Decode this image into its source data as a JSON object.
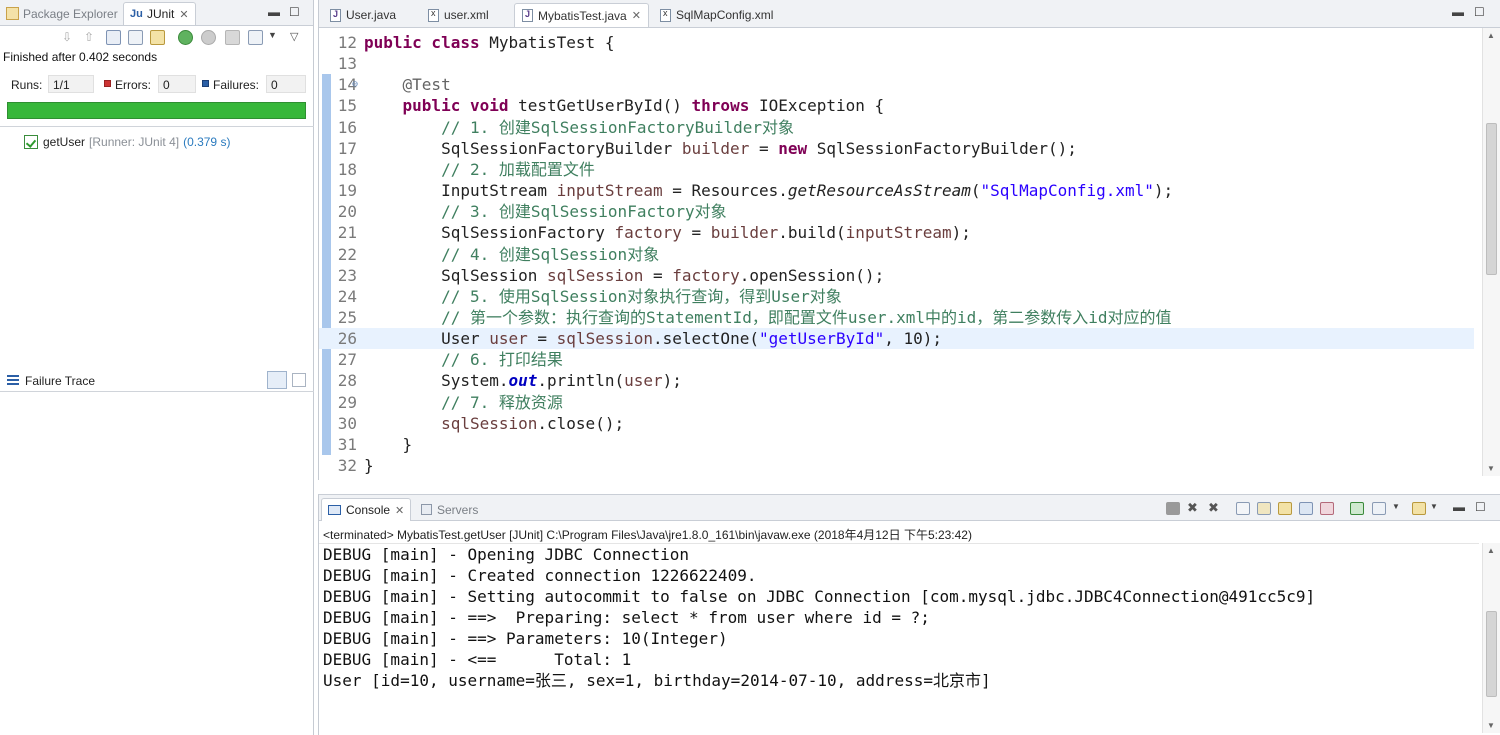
{
  "left_tabs": {
    "package_explorer": "Package Explorer",
    "junit": "JUnit"
  },
  "junit": {
    "finished": "Finished after 0.402 seconds",
    "runs_label": "Runs:",
    "runs_value": "1/1",
    "errors_label": "Errors:",
    "errors_value": "0",
    "failures_label": "Failures:",
    "failures_value": "0",
    "progress": 1.0,
    "progress_color": "#37b73a",
    "test_name": "getUser",
    "test_runner": "[Runner: JUnit 4]",
    "test_time": "(0.379 s)",
    "failure_trace": "Failure Trace"
  },
  "editor": {
    "tabs": [
      {
        "label": "User.java",
        "icon": "java-file-icon"
      },
      {
        "label": "user.xml",
        "icon": "xml-file-icon"
      },
      {
        "label": "MybatisTest.java",
        "icon": "java-file-icon",
        "active": true
      },
      {
        "label": "SqlMapConfig.xml",
        "icon": "xml-file-icon"
      }
    ],
    "lines": [
      {
        "n": "12",
        "html": "<span class=\"kw\">public class</span> MybatisTest {"
      },
      {
        "n": "13",
        "html": ""
      },
      {
        "n": "14",
        "html": "    <span class=\"ann\">@Test</span>",
        "fold": true
      },
      {
        "n": "15",
        "html": "    <span class=\"kw\">public void</span> testGetUserById() <span class=\"kw\">throws</span> IOException {"
      },
      {
        "n": "16",
        "html": "        <span class=\"cm\">// 1. 创建SqlSessionFactoryBuilder对象</span>"
      },
      {
        "n": "17",
        "html": "        SqlSessionFactoryBuilder <span class=\"var\">builder</span> = <span class=\"kw\">new</span> SqlSessionFactoryBuilder();"
      },
      {
        "n": "18",
        "html": "        <span class=\"cm\">// 2. 加载配置文件</span>"
      },
      {
        "n": "19",
        "html": "        InputStream <span class=\"var\">inputStream</span> = Resources.<span class=\"it\">getResourceAsStream</span>(<span class=\"str\">\"SqlMapConfig.xml\"</span>);"
      },
      {
        "n": "20",
        "html": "        <span class=\"cm\">// 3. 创建SqlSessionFactory对象</span>"
      },
      {
        "n": "21",
        "html": "        SqlSessionFactory <span class=\"var\">factory</span> = <span class=\"var\">builder</span>.build(<span class=\"var\">inputStream</span>);"
      },
      {
        "n": "22",
        "html": "        <span class=\"cm\">// 4. 创建SqlSession对象</span>"
      },
      {
        "n": "23",
        "html": "        SqlSession <span class=\"var\">sqlSession</span> = <span class=\"var\">factory</span>.openSession();"
      },
      {
        "n": "24",
        "html": "        <span class=\"cm\">// 5. 使用SqlSession对象执行查询，得到User对象</span>"
      },
      {
        "n": "25",
        "html": "        <span class=\"cm\">// 第一个参数：执行查询的StatementId，即配置文件user.xml中的id，第二参数传入id对应的值</span>"
      },
      {
        "n": "26",
        "html": "        User <span class=\"var\">user</span> = <span class=\"var\">sqlSession</span>.selectOne(<span class=\"str\">\"getUserById\"</span>, 10);",
        "current": true
      },
      {
        "n": "27",
        "html": "        <span class=\"cm\">// 6. 打印结果</span>"
      },
      {
        "n": "28",
        "html": "        System.<span class=\"fld\">out</span>.println(<span class=\"var\">user</span>);"
      },
      {
        "n": "29",
        "html": "        <span class=\"cm\">// 7. 释放资源</span>"
      },
      {
        "n": "30",
        "html": "        <span class=\"var\">sqlSession</span>.close();"
      },
      {
        "n": "31",
        "html": "    }"
      },
      {
        "n": "32",
        "html": "}"
      }
    ]
  },
  "console": {
    "tab_console": "Console",
    "tab_servers": "Servers",
    "status": "<terminated> MybatisTest.getUser [JUnit] C:\\Program Files\\Java\\jre1.8.0_161\\bin\\javaw.exe (2018年4月12日 下午5:23:42)",
    "output": [
      "DEBUG [main] - Opening JDBC Connection",
      "DEBUG [main] - Created connection 1226622409.",
      "DEBUG [main] - Setting autocommit to false on JDBC Connection [com.mysql.jdbc.JDBC4Connection@491cc5c9]",
      "DEBUG [main] - ==>  Preparing: select * from user where id = ?;",
      "DEBUG [main] - ==> Parameters: 10(Integer)",
      "DEBUG [main] - <==      Total: 1",
      "User [id=10, username=张三, sex=1, birthday=2014-07-10, address=北京市]"
    ]
  }
}
